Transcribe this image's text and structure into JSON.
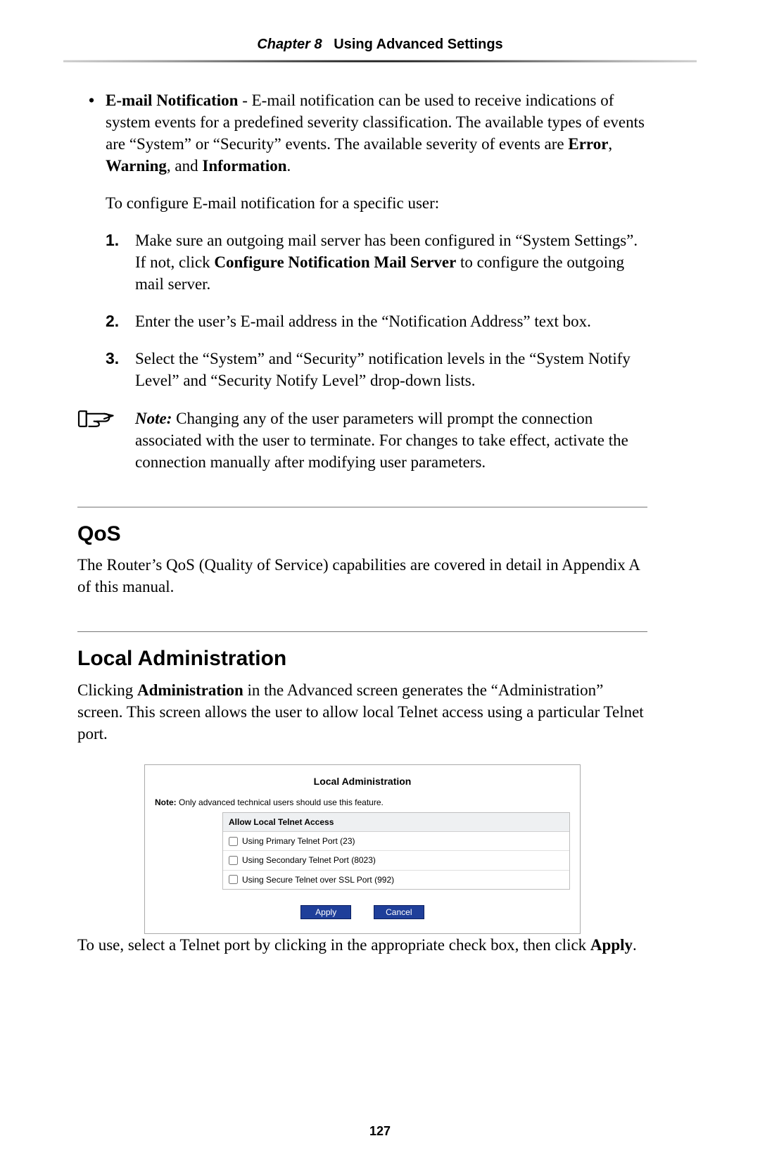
{
  "header": {
    "chapter_label": "Chapter 8",
    "chapter_title": "Using Advanced Settings"
  },
  "email_section": {
    "item_label": "E-mail Notification",
    "item_text_1": " - E-mail notification can be used to receive indications of system events for a predefined severity classification. The available types of events are “System” or “Security” events. The available severity of events are ",
    "bold_a": "Error",
    "sep_a": ", ",
    "bold_b": "Warning",
    "sep_b": ", and ",
    "bold_c": "Information",
    "tail": ".",
    "configure_line": "To configure E-mail notification for a specific user:",
    "steps": [
      {
        "num": "1.",
        "pre": "Make sure an outgoing mail server has been configured in “System Settings”. If not, click ",
        "bold": "Configure Notification Mail Server",
        "post": " to configure the outgoing mail server."
      },
      {
        "num": "2.",
        "pre": "Enter the user’s E-mail address in the “Notification Address” text box.",
        "bold": "",
        "post": ""
      },
      {
        "num": "3.",
        "pre": "Select the “System” and “Security” notification levels in the “System Notify Level” and “Security Notify Level” drop-down lists.",
        "bold": "",
        "post": ""
      }
    ],
    "note_label": "Note:",
    "note_text": " Changing any of the user parameters will prompt the connection associated with the user to terminate. For changes to take effect, activate the connection manually after modifying user parameters."
  },
  "qos": {
    "heading": "QoS",
    "body": "The Router’s QoS (Quality of Service) capabilities are covered in detail in Appendix A of this manual."
  },
  "local_admin": {
    "heading": "Local Administration",
    "body_pre": "Clicking ",
    "body_bold": "Administration",
    "body_post": " in the Advanced screen generates the “Administration” screen. This screen allows the user to allow local Telnet access using a particular Telnet port.",
    "ui": {
      "title": "Local Administration",
      "note_label": "Note:",
      "note_text": " Only advanced technical users should use this feature.",
      "panel_heading": "Allow Local Telnet Access",
      "rows": [
        "Using Primary Telnet Port (23)",
        "Using Secondary Telnet Port (8023)",
        "Using Secure Telnet over SSL Port (992)"
      ],
      "apply_label": "Apply",
      "cancel_label": "Cancel"
    },
    "after_pre": "To use, select a Telnet port by clicking in the appropriate check box, then click ",
    "after_bold": "Apply",
    "after_post": "."
  },
  "page_number": "127"
}
